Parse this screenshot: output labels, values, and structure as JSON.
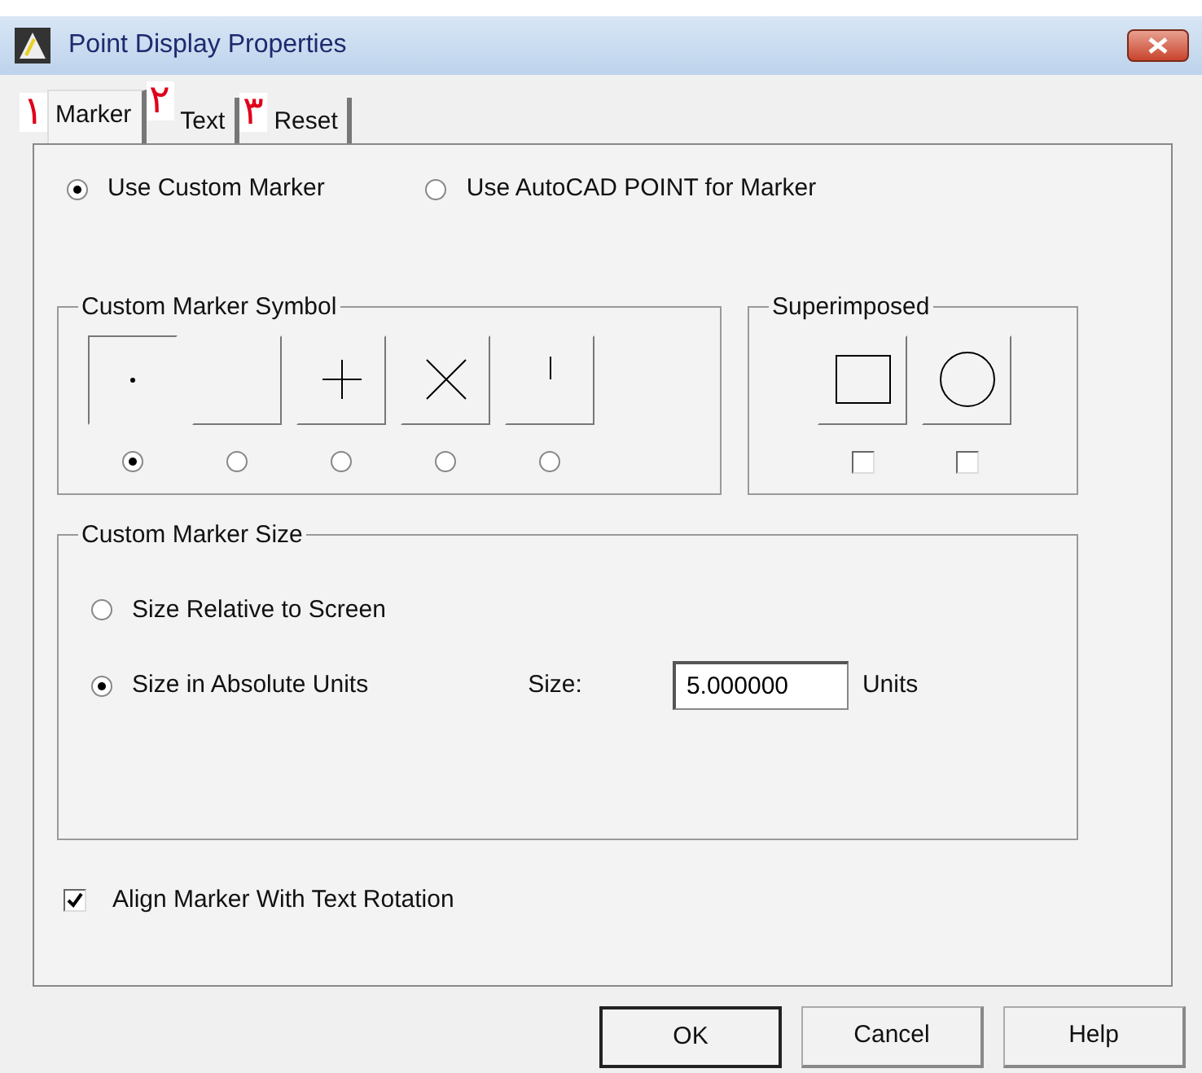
{
  "window": {
    "title": "Point Display Properties"
  },
  "tabs": [
    {
      "label": "Marker",
      "selected": true
    },
    {
      "label": "Text",
      "selected": false
    },
    {
      "label": "Reset",
      "selected": false
    }
  ],
  "annotations": [
    "۱",
    "۲",
    "۳"
  ],
  "marker_mode": [
    {
      "label": "Use Custom Marker",
      "selected": true
    },
    {
      "label": "Use AutoCAD POINT for Marker",
      "selected": false
    }
  ],
  "custom_marker_symbol": {
    "title": "Custom Marker Symbol",
    "symbols": [
      {
        "kind": "dot",
        "selected": true
      },
      {
        "kind": "none",
        "selected": false
      },
      {
        "kind": "plus",
        "selected": false
      },
      {
        "kind": "cross",
        "selected": false
      },
      {
        "kind": "tick",
        "selected": false
      }
    ]
  },
  "superimposed": {
    "title": "Superimposed",
    "symbols": [
      {
        "kind": "square",
        "checked": false
      },
      {
        "kind": "circle",
        "checked": false
      }
    ]
  },
  "custom_marker_size": {
    "title": "Custom Marker Size",
    "options": [
      {
        "label": "Size Relative to Screen",
        "selected": false
      },
      {
        "label": "Size in Absolute Units",
        "selected": true
      }
    ],
    "size_label": "Size:",
    "size_value": "5.000000",
    "units_label": "Units"
  },
  "align_with_text_rotation": {
    "label": "Align Marker With Text Rotation",
    "checked": true
  },
  "buttons": [
    {
      "label": "OK",
      "default": true
    },
    {
      "label": "Cancel",
      "default": false
    },
    {
      "label": "Help",
      "default": false
    }
  ]
}
